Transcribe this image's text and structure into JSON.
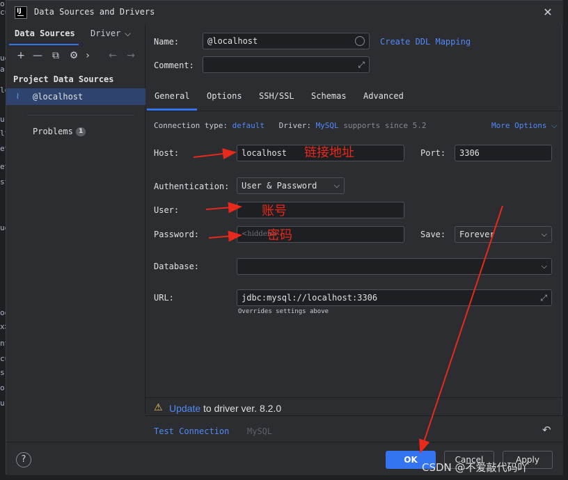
{
  "window": {
    "title": "Data Sources and Drivers",
    "app_icon_text": "IJ",
    "close_icon": "close-icon"
  },
  "left_panel": {
    "tabs": [
      {
        "label": "Data Sources"
      },
      {
        "label": "Driver"
      }
    ],
    "toolbar_icons": [
      "plus-icon",
      "minus-icon",
      "copy-icon",
      "settings-icon",
      "expand-icon",
      "back-icon",
      "forward-icon"
    ],
    "section_title": "Project Data Sources",
    "items": [
      {
        "label": "@localhost",
        "icon": "mysql-icon"
      }
    ],
    "problems": {
      "label": "Problems",
      "count": "1"
    }
  },
  "form": {
    "name_label": "Name:",
    "name_value": "@localhost",
    "ddl_link": "Create DDL Mapping",
    "comment_label": "Comment:",
    "comment_value": "",
    "tabs": [
      "General",
      "Options",
      "SSH/SSL",
      "Schemas",
      "Advanced"
    ],
    "active_tab": "General",
    "connection_type_label": "Connection type:",
    "connection_type_value": "default",
    "driver_label": "Driver:",
    "driver_value": "MySQL",
    "driver_note": "supports since 5.2",
    "more_options": "More Options",
    "host_label": "Host:",
    "host_value": "localhost",
    "port_label": "Port:",
    "port_value": "3306",
    "auth_label": "Authentication:",
    "auth_value": "User & Password",
    "user_label": "User:",
    "user_value": "",
    "password_label": "Password:",
    "password_placeholder": "<hidden>",
    "save_label": "Save:",
    "save_value": "Forever",
    "database_label": "Database:",
    "database_value": "",
    "url_label": "URL:",
    "url_value": "jdbc:mysql://localhost:3306",
    "url_note": "Overrides settings above",
    "update_link": "Update",
    "update_text": " to driver ver. 8.2.0"
  },
  "test_bar": {
    "test_connection": "Test Connection",
    "driver_name": "MySQL",
    "reset_icon": "undo-icon"
  },
  "footer": {
    "help": "?",
    "ok": "OK",
    "cancel": "Cancel",
    "apply": "Apply"
  },
  "annotations": {
    "host": "链接地址",
    "user": "账号",
    "password": "密码"
  },
  "watermark": "CSDN @不爱敲代码吖",
  "editor_strip_glyphs": [
    "o",
    "cu",
    "ue",
    "a",
    "lo",
    "ur",
    "lt",
    "et",
    "et",
    "st",
    "ue",
    "oo",
    "x>",
    "nt",
    "cu",
    "s",
    "or",
    "ur"
  ],
  "colors": {
    "accent": "#3574f0",
    "link": "#548af7",
    "annotation": "#e8291c",
    "selection": "#2e436e"
  }
}
